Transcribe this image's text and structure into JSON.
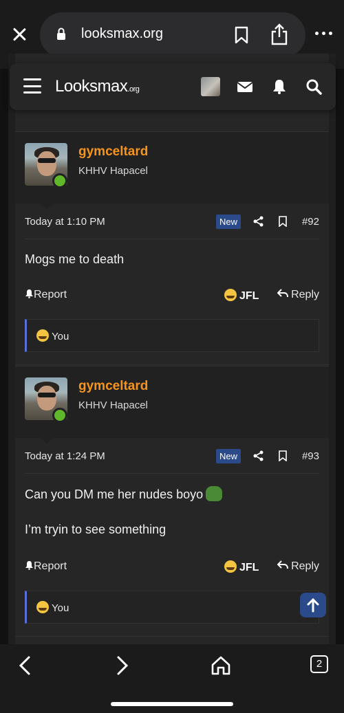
{
  "browser": {
    "url": "looksmax.org",
    "tab_count": "2"
  },
  "ghost": {
    "left": "Report",
    "right": "Reply"
  },
  "header": {
    "logo_main": "Looksmax",
    "logo_tld": ".org"
  },
  "posts": [
    {
      "username": "gymceltard",
      "user_title": "KHHV Hapacel",
      "date": "Today at 1:10 PM",
      "badge": "New",
      "number": "#92",
      "body_lines": [
        "Mogs me to death"
      ],
      "report_label": "Report",
      "reaction_label": "JFL",
      "reply_label": "Reply",
      "reacted_by": "You"
    },
    {
      "username": "gymceltard",
      "user_title": "KHHV Hapacel",
      "date": "Today at 1:24 PM",
      "badge": "New",
      "number": "#93",
      "body_lines": [
        "Can you DM me her nudes boyo",
        "I’m tryin to see something"
      ],
      "report_label": "Report",
      "reaction_label": "JFL",
      "reply_label": "Reply",
      "reacted_by": "You"
    }
  ],
  "colors": {
    "username": "#f7941d",
    "badge_bg": "#2b4a8a",
    "online": "#5fb72a",
    "reaction_border": "#5a6fd8"
  }
}
